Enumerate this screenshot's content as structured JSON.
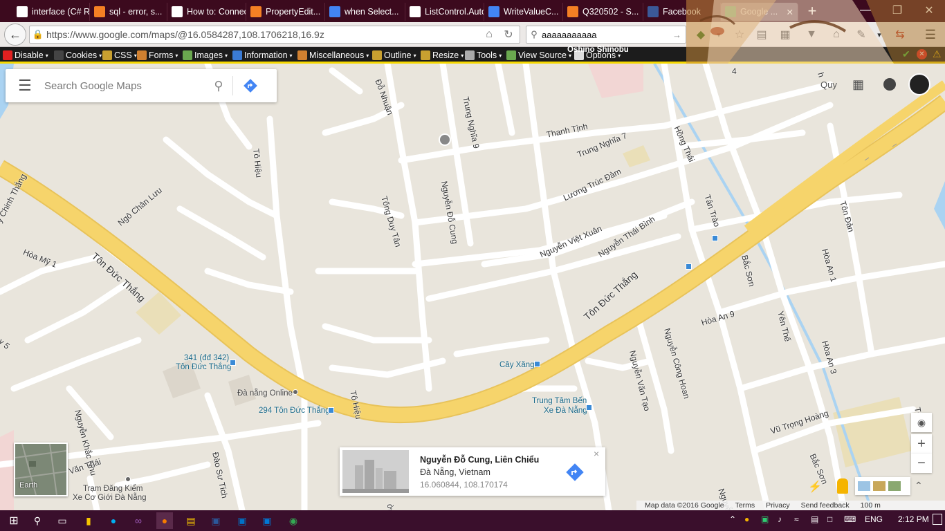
{
  "browser": {
    "tabs": [
      {
        "label": "interface (C# Re...",
        "color": "#ffffff"
      },
      {
        "label": "sql - error, s...",
        "color": "#f48024"
      },
      {
        "label": "How to: Connec...",
        "color": "#ffffff"
      },
      {
        "label": "PropertyEdit...",
        "color": "#f48024"
      },
      {
        "label": "when Select...",
        "color": "#4285f4"
      },
      {
        "label": "ListControl.Auto...",
        "color": "#ffffff"
      },
      {
        "label": "WriteValueC...",
        "color": "#4285f4"
      },
      {
        "label": "Q320502 - S...",
        "color": "#f48024"
      },
      {
        "label": "Facebook",
        "color": "#3b5998"
      },
      {
        "label": "Google ...",
        "color": "#34a853"
      }
    ],
    "new_tab": "+",
    "url": "https://www.google.com/maps/@16.0584287,108.1706218,16.9z",
    "search_query": "aaaaaaaaaaa"
  },
  "devtoolbar": {
    "items": [
      "Disable",
      "Cookies",
      "CSS",
      "Forms",
      "Images",
      "Information",
      "Miscellaneous",
      "Outline",
      "Resize",
      "Tools",
      "View Source",
      "Options"
    ],
    "persona_name": "Oshino Shinobu"
  },
  "maps": {
    "search_placeholder": "Search Google Maps",
    "account_label": "Quy",
    "streets": [
      {
        "name": "Tôn Đức Thắng"
      },
      {
        "name": "Tôn Đức Thắng"
      },
      {
        "name": "Đỗ Nhuận"
      },
      {
        "name": "Trung Nghĩa 9"
      },
      {
        "name": "Thanh Tịnh"
      },
      {
        "name": "Trung Nghĩa 7"
      },
      {
        "name": "Tô Hiệu"
      },
      {
        "name": "Nguyễn Đỗ Cung"
      },
      {
        "name": "Tống Duy Tân"
      },
      {
        "name": "Lương Trúc Đàm"
      },
      {
        "name": "Ngô Chân Lưu"
      },
      {
        "name": "Nguyễn Việt Xuân"
      },
      {
        "name": "Nguyễn Thái Bình"
      },
      {
        "name": "Hồng Thái"
      },
      {
        "name": "Tân Trào"
      },
      {
        "name": "Tôn Đản"
      },
      {
        "name": "Bắc Sơn"
      },
      {
        "name": "Hòa An 1"
      },
      {
        "name": "Hòa An 9"
      },
      {
        "name": "Yên Thế"
      },
      {
        "name": "Hòa An 3"
      },
      {
        "name": "Nguyễn Công Hoan"
      },
      {
        "name": "Nguyễn Văn Tạo"
      },
      {
        "name": "Hòa Mỹ 1"
      },
      {
        "name": "y Chinh Thắng"
      },
      {
        "name": "Nguyễn Khắc Nhu"
      },
      {
        "name": "Tô Hiệu"
      },
      {
        "name": "Đào Sư Tích"
      },
      {
        "name": "Văn Thái"
      },
      {
        "name": "Vũ Trọng Hoàng"
      },
      {
        "name": "Bắc Sơn"
      },
      {
        "name": "Nguyễn C"
      },
      {
        "name": "ờng"
      },
      {
        "name": "Tô"
      },
      {
        "name": "h"
      },
      {
        "name": "4"
      },
      {
        "name": "y 5"
      }
    ],
    "pois": [
      {
        "name": "341 (đđ 342)"
      },
      {
        "name": "Tôn Đức Thắng"
      },
      {
        "name": "Đà nẵng Online"
      },
      {
        "name": "294 Tôn Đức Thắng"
      },
      {
        "name": "Cây Xăng"
      },
      {
        "name": "Trung Tâm Bến"
      },
      {
        "name": "Xe Đà Nẵng"
      },
      {
        "name": "Trạm Đăng Kiểm"
      },
      {
        "name": "Xe Cơ Giới Đà Nẵng"
      }
    ],
    "card": {
      "title": "Nguyễn Đỗ Cung, Liên Chiểu",
      "subtitle": "Đà Nẵng, Vietnam",
      "coords": "16.060844, 108.170174",
      "close": "×"
    },
    "earth_label": "Earth",
    "footer": {
      "data": "Map data ©2016 Google",
      "terms": "Terms",
      "privacy": "Privacy",
      "feedback": "Send feedback",
      "scale": "100 m"
    },
    "zoom_in": "+",
    "zoom_out": "−",
    "colors": {
      "road_major": "#f6d46b",
      "road": "#ffffff",
      "land": "#e9e5dc",
      "water": "#aad3f2",
      "accent": "#4285f4"
    }
  },
  "taskbar": {
    "language": "ENG",
    "time": "2:12 PM"
  }
}
